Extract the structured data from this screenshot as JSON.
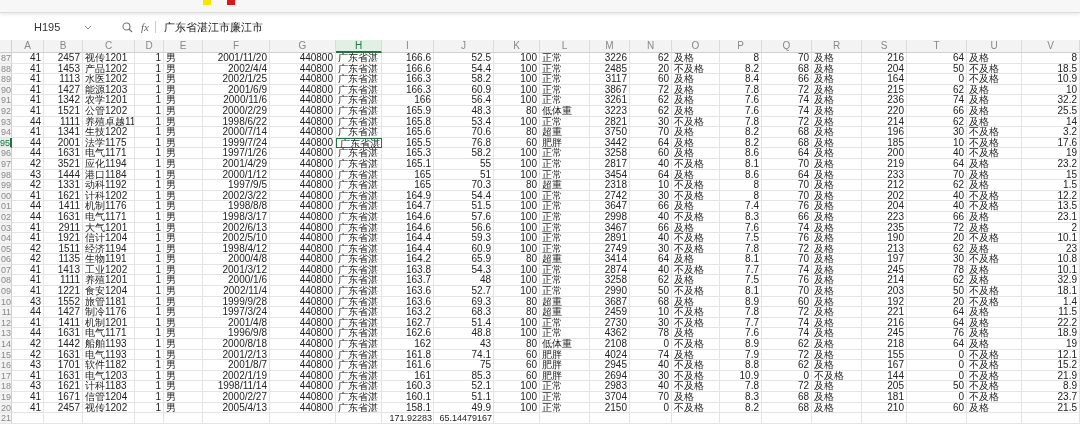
{
  "formula_bar": {
    "cell_reference": "H195",
    "function_label": "fx",
    "formula": "广东省湛江市廉江市"
  },
  "columns": [
    {
      "letter": "A",
      "kind": "number",
      "selected": false
    },
    {
      "letter": "B",
      "kind": "number",
      "selected": false
    },
    {
      "letter": "C",
      "kind": "text",
      "selected": false
    },
    {
      "letter": "D",
      "kind": "number",
      "selected": false
    },
    {
      "letter": "E",
      "kind": "text",
      "selected": false
    },
    {
      "letter": "F",
      "kind": "number",
      "selected": false
    },
    {
      "letter": "G",
      "kind": "number",
      "selected": false
    },
    {
      "letter": "H",
      "kind": "text",
      "selected": true
    },
    {
      "letter": "I",
      "kind": "number",
      "selected": false
    },
    {
      "letter": "J",
      "kind": "number",
      "selected": false
    },
    {
      "letter": "K",
      "kind": "number",
      "selected": false
    },
    {
      "letter": "L",
      "kind": "text",
      "selected": false
    },
    {
      "letter": "M",
      "kind": "number",
      "selected": false
    },
    {
      "letter": "N",
      "kind": "number",
      "selected": false
    },
    {
      "letter": "O",
      "kind": "text",
      "selected": false
    },
    {
      "letter": "P",
      "kind": "number",
      "selected": false
    },
    {
      "letter": "Q",
      "kind": "number",
      "selected": false
    },
    {
      "letter": "R",
      "kind": "text",
      "selected": false
    },
    {
      "letter": "S",
      "kind": "number",
      "selected": false
    },
    {
      "letter": "T",
      "kind": "number",
      "selected": false
    },
    {
      "letter": "U",
      "kind": "text",
      "selected": false
    },
    {
      "letter": "V",
      "kind": "number",
      "selected": false
    }
  ],
  "rows": [
    {
      "number": "87",
      "selected": false,
      "cells": [
        "41",
        "2457",
        "视传1201",
        "1",
        "男",
        "2001/11/20",
        "440800",
        "广东省湛",
        "166.6",
        "52.5",
        "100",
        "正常",
        "3226",
        "62",
        "及格",
        "8",
        "70",
        "及格",
        "216",
        "64",
        "及格",
        "8"
      ]
    },
    {
      "number": "88",
      "selected": false,
      "cells": [
        "41",
        "1453",
        "产品1202",
        "1",
        "男",
        "2002/4/4",
        "440800",
        "广东省湛",
        "166.6",
        "54.4",
        "100",
        "正常",
        "2485",
        "20",
        "不及格",
        "8.2",
        "68",
        "及格",
        "204",
        "50",
        "不及格",
        "18.5"
      ]
    },
    {
      "number": "89",
      "selected": false,
      "cells": [
        "41",
        "1113",
        "水医1202",
        "1",
        "男",
        "2002/1/25",
        "440800",
        "广东省湛",
        "166.3",
        "58.2",
        "100",
        "正常",
        "3117",
        "60",
        "及格",
        "8.4",
        "66",
        "及格",
        "164",
        "0",
        "不及格",
        "10.9"
      ]
    },
    {
      "number": "90",
      "selected": false,
      "cells": [
        "41",
        "1427",
        "能源1203",
        "1",
        "男",
        "2001/6/9",
        "440800",
        "广东省湛",
        "166.3",
        "60.9",
        "100",
        "正常",
        "3867",
        "72",
        "及格",
        "7.8",
        "72",
        "及格",
        "215",
        "62",
        "及格",
        "10"
      ]
    },
    {
      "number": "91",
      "selected": false,
      "cells": [
        "41",
        "1342",
        "农学1201",
        "1",
        "男",
        "2000/11/6",
        "440800",
        "广东省湛",
        "166",
        "56.4",
        "100",
        "正常",
        "3261",
        "62",
        "及格",
        "7.6",
        "74",
        "及格",
        "236",
        "74",
        "及格",
        "32.2"
      ]
    },
    {
      "number": "92",
      "selected": false,
      "cells": [
        "41",
        "1521",
        "公管1202",
        "1",
        "男",
        "2000/2/29",
        "440800",
        "广东省湛",
        "165.9",
        "48.3",
        "80",
        "低体重",
        "3223",
        "62",
        "及格",
        "7.6",
        "74",
        "及格",
        "220",
        "66",
        "及格",
        "25.5"
      ]
    },
    {
      "number": "93",
      "selected": false,
      "cells": [
        "44",
        "1111",
        "养殖卓越11",
        "1",
        "男",
        "1998/6/22",
        "440800",
        "广东省湛",
        "165.8",
        "53.4",
        "100",
        "正常",
        "2821",
        "30",
        "不及格",
        "7.8",
        "72",
        "及格",
        "214",
        "62",
        "及格",
        "14"
      ]
    },
    {
      "number": "94",
      "selected": false,
      "cells": [
        "41",
        "1341",
        "生技1202",
        "1",
        "男",
        "2000/7/14",
        "440800",
        "广东省湛",
        "165.6",
        "70.6",
        "80",
        "超重",
        "3750",
        "70",
        "及格",
        "8.2",
        "68",
        "及格",
        "196",
        "30",
        "不及格",
        "3.2"
      ]
    },
    {
      "number": "95",
      "selected": true,
      "cells": [
        "44",
        "2001",
        "法学1175",
        "1",
        "男",
        "1999/7/24",
        "440800",
        "广东省湛",
        "165.5",
        "76.8",
        "60",
        "肥胖",
        "3442",
        "64",
        "及格",
        "8.2",
        "68",
        "及格",
        "185",
        "10",
        "不及格",
        "17.6"
      ]
    },
    {
      "number": "96",
      "selected": false,
      "cells": [
        "44",
        "1631",
        "电气1171",
        "1",
        "男",
        "1997/1/26",
        "440800",
        "广东省湛",
        "165.3",
        "58.2",
        "100",
        "正常",
        "3258",
        "60",
        "及格",
        "8.6",
        "64",
        "及格",
        "200",
        "40",
        "不及格",
        "19"
      ]
    },
    {
      "number": "97",
      "selected": false,
      "cells": [
        "42",
        "3521",
        "应化1194",
        "1",
        "男",
        "2001/4/29",
        "440800",
        "广东省湛",
        "165.1",
        "55",
        "100",
        "正常",
        "2817",
        "40",
        "不及格",
        "8.1",
        "70",
        "及格",
        "219",
        "64",
        "及格",
        "23.2"
      ]
    },
    {
      "number": "98",
      "selected": false,
      "cells": [
        "43",
        "1444",
        "港口1184",
        "1",
        "男",
        "2000/1/12",
        "440800",
        "广东省湛",
        "165",
        "51",
        "100",
        "正常",
        "3454",
        "64",
        "及格",
        "8.6",
        "64",
        "及格",
        "233",
        "70",
        "及格",
        "15"
      ]
    },
    {
      "number": "99",
      "selected": false,
      "cells": [
        "42",
        "1331",
        "动科1192",
        "1",
        "男",
        "1997/9/5",
        "440800",
        "广东省湛",
        "165",
        "70.3",
        "80",
        "超重",
        "2318",
        "10",
        "不及格",
        "8",
        "70",
        "及格",
        "212",
        "62",
        "及格",
        "1.5"
      ]
    },
    {
      "number": "00",
      "selected": false,
      "cells": [
        "41",
        "1621",
        "计科1202",
        "1",
        "男",
        "2002/3/22",
        "440800",
        "广东省湛",
        "164.9",
        "54.4",
        "100",
        "正常",
        "2742",
        "30",
        "不及格",
        "8",
        "70",
        "及格",
        "202",
        "40",
        "不及格",
        "12.2"
      ]
    },
    {
      "number": "01",
      "selected": false,
      "cells": [
        "44",
        "1411",
        "机制1176",
        "1",
        "男",
        "1998/8/8",
        "440800",
        "广东省湛",
        "164.7",
        "51.5",
        "100",
        "正常",
        "3647",
        "66",
        "及格",
        "7.4",
        "76",
        "及格",
        "204",
        "40",
        "不及格",
        "13.5"
      ]
    },
    {
      "number": "02",
      "selected": false,
      "cells": [
        "44",
        "1631",
        "电气1171",
        "1",
        "男",
        "1998/3/17",
        "440800",
        "广东省湛",
        "164.6",
        "57.6",
        "100",
        "正常",
        "2998",
        "40",
        "不及格",
        "8.3",
        "66",
        "及格",
        "223",
        "66",
        "及格",
        "23.1"
      ]
    },
    {
      "number": "03",
      "selected": false,
      "cells": [
        "41",
        "2911",
        "大气1201",
        "1",
        "男",
        "2002/6/13",
        "440800",
        "广东省湛",
        "164.6",
        "56.6",
        "100",
        "正常",
        "3467",
        "66",
        "及格",
        "7.6",
        "74",
        "及格",
        "235",
        "72",
        "及格",
        "2"
      ]
    },
    {
      "number": "04",
      "selected": false,
      "cells": [
        "41",
        "1921",
        "信计1204",
        "1",
        "男",
        "2002/5/10",
        "440800",
        "广东省湛",
        "164.4",
        "59.3",
        "100",
        "正常",
        "2891",
        "40",
        "不及格",
        "7.5",
        "76",
        "及格",
        "190",
        "20",
        "不及格",
        "10.1"
      ]
    },
    {
      "number": "05",
      "selected": false,
      "cells": [
        "42",
        "1511",
        "经济1194",
        "1",
        "男",
        "1998/4/12",
        "440800",
        "广东省湛",
        "164.4",
        "60.9",
        "100",
        "正常",
        "2749",
        "30",
        "不及格",
        "7.8",
        "72",
        "及格",
        "213",
        "62",
        "及格",
        "23"
      ]
    },
    {
      "number": "06",
      "selected": false,
      "cells": [
        "42",
        "1135",
        "生物1191",
        "1",
        "男",
        "2000/4/8",
        "440800",
        "广东省湛",
        "164.2",
        "65.9",
        "80",
        "超重",
        "3414",
        "64",
        "及格",
        "8.1",
        "70",
        "及格",
        "197",
        "30",
        "不及格",
        "10.8"
      ]
    },
    {
      "number": "07",
      "selected": false,
      "cells": [
        "41",
        "1413",
        "工业1202",
        "1",
        "男",
        "2001/3/12",
        "440800",
        "广东省湛",
        "163.8",
        "54.3",
        "100",
        "正常",
        "2874",
        "40",
        "不及格",
        "7.7",
        "74",
        "及格",
        "245",
        "78",
        "及格",
        "10.1"
      ]
    },
    {
      "number": "08",
      "selected": false,
      "cells": [
        "41",
        "1111",
        "养殖1201",
        "1",
        "男",
        "2000/1/6",
        "440800",
        "广东省湛",
        "163.7",
        "48",
        "100",
        "正常",
        "3258",
        "62",
        "及格",
        "7.5",
        "76",
        "及格",
        "214",
        "62",
        "及格",
        "32.9"
      ]
    },
    {
      "number": "09",
      "selected": false,
      "cells": [
        "41",
        "1221",
        "食安1204",
        "1",
        "男",
        "2002/11/4",
        "440800",
        "广东省湛",
        "163.6",
        "52.7",
        "100",
        "正常",
        "2990",
        "50",
        "不及格",
        "8.1",
        "70",
        "及格",
        "203",
        "50",
        "不及格",
        "18.1"
      ]
    },
    {
      "number": "10",
      "selected": false,
      "cells": [
        "43",
        "1552",
        "旅管1181",
        "1",
        "男",
        "1999/9/28",
        "440800",
        "广东省湛",
        "163.6",
        "69.3",
        "80",
        "超重",
        "3687",
        "68",
        "及格",
        "8.9",
        "60",
        "及格",
        "192",
        "20",
        "不及格",
        "1.4"
      ]
    },
    {
      "number": "11",
      "selected": false,
      "cells": [
        "44",
        "1427",
        "制冷1176",
        "1",
        "男",
        "1997/3/24",
        "440800",
        "广东省湛",
        "163.2",
        "68.3",
        "80",
        "超重",
        "2459",
        "10",
        "不及格",
        "7.8",
        "72",
        "及格",
        "221",
        "64",
        "及格",
        "11.5"
      ]
    },
    {
      "number": "12",
      "selected": false,
      "cells": [
        "41",
        "1411",
        "机制1201",
        "1",
        "男",
        "2001/4/8",
        "440800",
        "广东省湛",
        "162.7",
        "51.4",
        "100",
        "正常",
        "2730",
        "30",
        "不及格",
        "7.7",
        "74",
        "及格",
        "216",
        "64",
        "及格",
        "22.2"
      ]
    },
    {
      "number": "13",
      "selected": false,
      "cells": [
        "44",
        "1631",
        "电气1171",
        "1",
        "男",
        "1996/9/8",
        "440800",
        "广东省湛",
        "162.6",
        "48.8",
        "100",
        "正常",
        "4362",
        "78",
        "及格",
        "7.6",
        "74",
        "及格",
        "245",
        "76",
        "及格",
        "18.9"
      ]
    },
    {
      "number": "14",
      "selected": false,
      "cells": [
        "42",
        "1442",
        "船舶1193",
        "1",
        "男",
        "2000/8/18",
        "440800",
        "广东省湛",
        "162",
        "43",
        "80",
        "低体重",
        "2108",
        "0",
        "不及格",
        "8.9",
        "62",
        "及格",
        "218",
        "64",
        "及格",
        "19"
      ]
    },
    {
      "number": "15",
      "selected": false,
      "cells": [
        "42",
        "1631",
        "电气1193",
        "1",
        "男",
        "2001/2/13",
        "440800",
        "广东省湛",
        "161.8",
        "74.1",
        "60",
        "肥胖",
        "4024",
        "74",
        "及格",
        "7.9",
        "72",
        "及格",
        "155",
        "0",
        "不及格",
        "12.1"
      ]
    },
    {
      "number": "16",
      "selected": false,
      "cells": [
        "43",
        "1701",
        "软件1182",
        "1",
        "男",
        "2001/8/7",
        "440800",
        "广东省湛",
        "161.6",
        "75",
        "60",
        "肥胖",
        "2945",
        "40",
        "不及格",
        "8.8",
        "62",
        "及格",
        "167",
        "0",
        "不及格",
        "15.2"
      ]
    },
    {
      "number": "17",
      "selected": false,
      "cells": [
        "41",
        "1631",
        "电气1203",
        "1",
        "男",
        "2002/1/19",
        "440800",
        "广东省湛",
        "161",
        "85.3",
        "60",
        "肥胖",
        "2694",
        "30",
        "不及格",
        "10.9",
        "0",
        "不及格",
        "144",
        "0",
        "不及格",
        "21.9"
      ]
    },
    {
      "number": "18",
      "selected": false,
      "cells": [
        "43",
        "1621",
        "计科1183",
        "1",
        "男",
        "1998/11/14",
        "440800",
        "广东省湛",
        "160.3",
        "52.1",
        "100",
        "正常",
        "2983",
        "40",
        "不及格",
        "7.8",
        "72",
        "及格",
        "205",
        "50",
        "不及格",
        "8.9"
      ]
    },
    {
      "number": "19",
      "selected": false,
      "cells": [
        "41",
        "1671",
        "信管1204",
        "1",
        "男",
        "2000/2/27",
        "440800",
        "广东省湛",
        "160.1",
        "51.1",
        "100",
        "正常",
        "3704",
        "70",
        "及格",
        "8.3",
        "68",
        "及格",
        "181",
        "0",
        "不及格",
        "23.7"
      ]
    },
    {
      "number": "20",
      "selected": false,
      "cells": [
        "41",
        "2457",
        "视传1202",
        "1",
        "男",
        "2005/4/13",
        "440800",
        "广东省湛",
        "158.1",
        "49.9",
        "100",
        "正常",
        "2150",
        "0",
        "不及格",
        "8.2",
        "68",
        "及格",
        "210",
        "60",
        "及格",
        "21.5"
      ]
    }
  ],
  "totals_row": {
    "number": "21",
    "selected": false,
    "cells": [
      {
        "kind": "blank"
      },
      {
        "kind": "blank"
      },
      {
        "kind": "blank"
      },
      {
        "kind": "blank"
      },
      {
        "kind": "blank"
      },
      {
        "kind": "blank"
      },
      {
        "kind": "blank"
      },
      {
        "kind": "blank"
      },
      {
        "kind": "value",
        "text": "171.92283"
      },
      {
        "kind": "value",
        "text": "65.14479167"
      },
      {
        "kind": "blank"
      },
      {
        "kind": "blank"
      },
      {
        "kind": "blank"
      },
      {
        "kind": "blank"
      },
      {
        "kind": "blank"
      },
      {
        "kind": "blank"
      },
      {
        "kind": "blank"
      },
      {
        "kind": "blank"
      },
      {
        "kind": "blank"
      },
      {
        "kind": "blank"
      },
      {
        "kind": "blank"
      },
      {
        "kind": "blank"
      }
    ]
  }
}
